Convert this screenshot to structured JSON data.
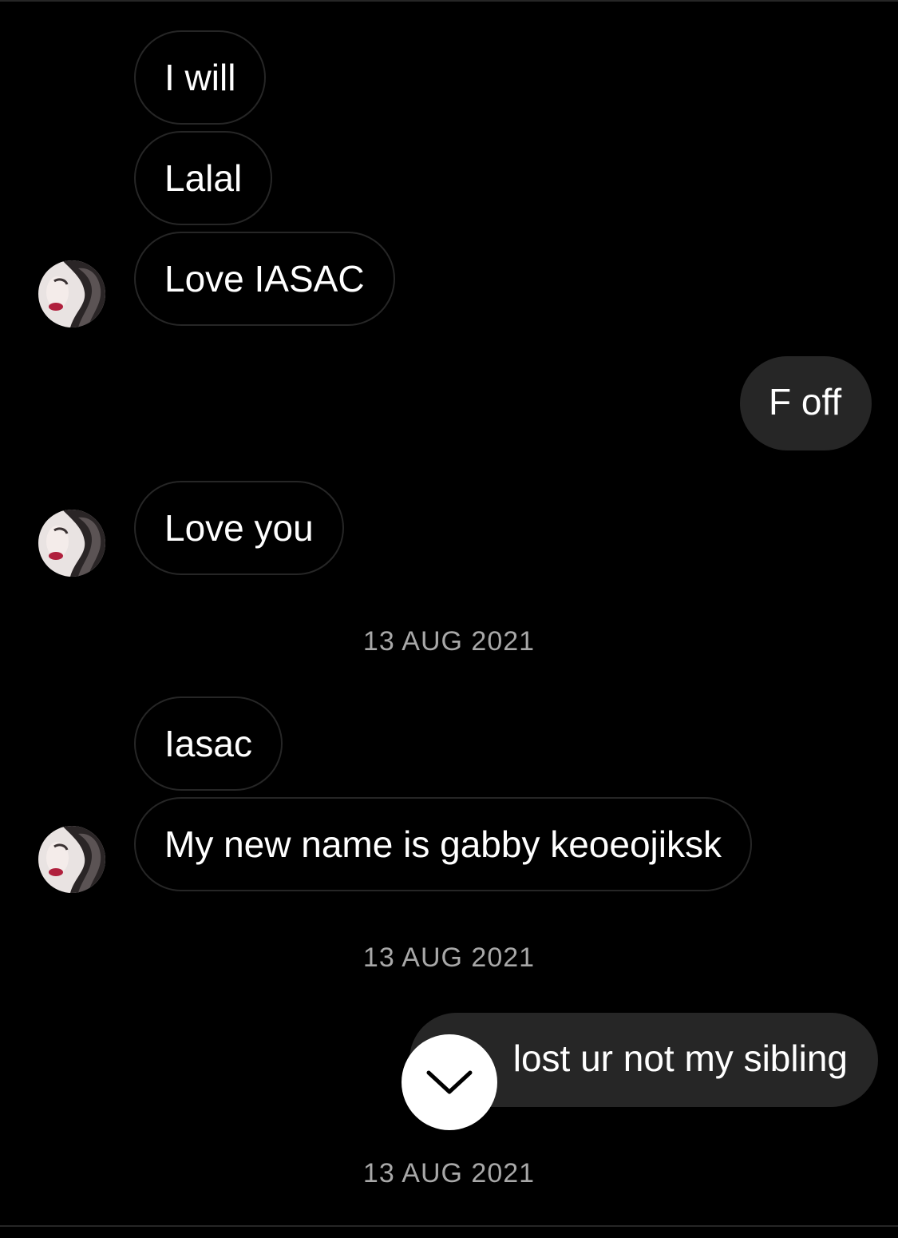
{
  "conversation": {
    "messages": [
      {
        "direction": "incoming",
        "text": "I will"
      },
      {
        "direction": "incoming",
        "text": "Lalal"
      },
      {
        "direction": "incoming",
        "text": "Love IASAC"
      },
      {
        "direction": "outgoing",
        "text": "F off"
      },
      {
        "direction": "incoming",
        "text": "Love you"
      },
      {
        "direction": "incoming",
        "text": "Iasac"
      },
      {
        "direction": "incoming",
        "text": "My new name is gabby keoeojiksk"
      },
      {
        "direction": "outgoing",
        "text": "lost ur not my sibling"
      }
    ],
    "date_separators": [
      "13 AUG 2021",
      "13 AUG 2021",
      "13 AUG 2021"
    ]
  },
  "contact": {
    "avatar_icon": "profile-photo"
  },
  "controls": {
    "scroll_down_icon": "chevron-down-icon"
  },
  "colors": {
    "background": "#000000",
    "incoming_border": "#262626",
    "outgoing_bubble": "#262626",
    "date_text": "#a8a8a8",
    "scroll_button": "#ffffff"
  }
}
